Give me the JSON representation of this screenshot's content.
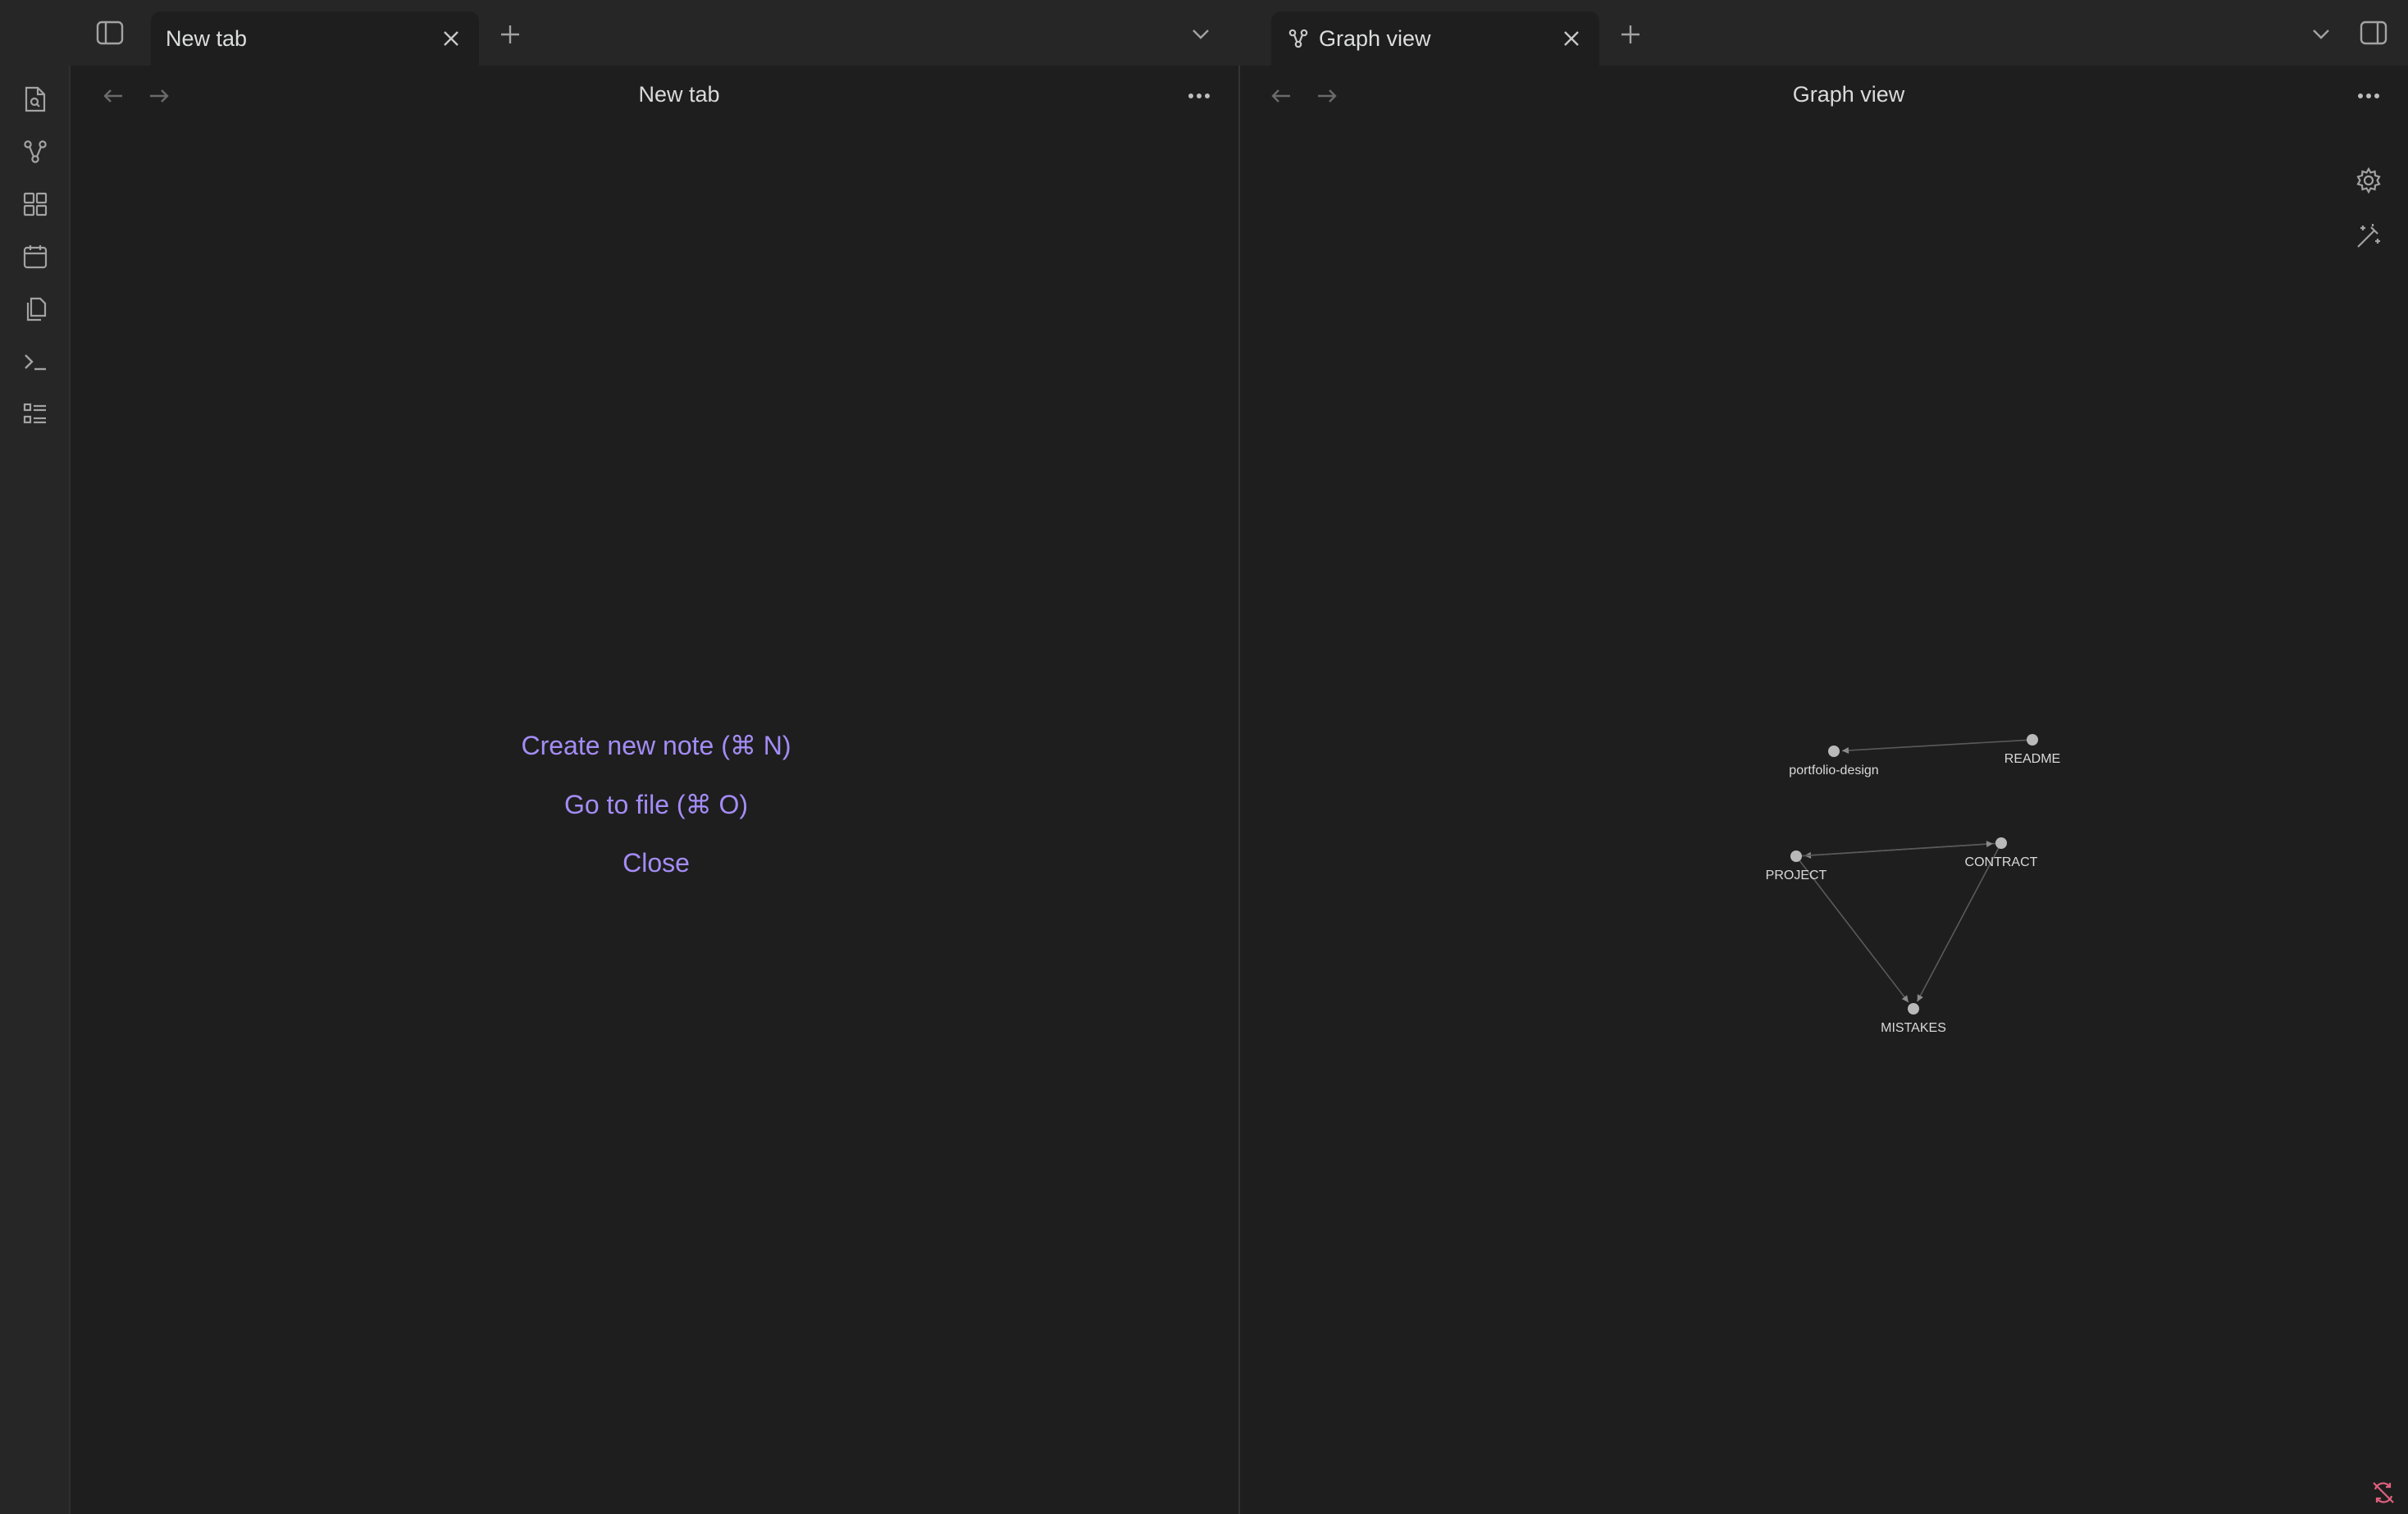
{
  "tabbar": {
    "left_tab": {
      "title": "New tab"
    },
    "right_tab": {
      "title": "Graph view"
    }
  },
  "left_pane": {
    "header_title": "New tab",
    "actions": {
      "create_note": "Create new note (⌘ N)",
      "go_to_file": "Go to file (⌘ O)",
      "close": "Close"
    }
  },
  "right_pane": {
    "header_title": "Graph view",
    "graph": {
      "nodes": [
        {
          "id": "portfolio-design",
          "label": "portfolio-design"
        },
        {
          "id": "README",
          "label": "README"
        },
        {
          "id": "PROJECT",
          "label": "PROJECT"
        },
        {
          "id": "CONTRACT",
          "label": "CONTRACT"
        },
        {
          "id": "MISTAKES",
          "label": "MISTAKES"
        }
      ],
      "links": [
        {
          "from": "README",
          "to": "portfolio-design"
        },
        {
          "from": "CONTRACT",
          "to": "PROJECT"
        },
        {
          "from": "PROJECT",
          "to": "CONTRACT"
        },
        {
          "from": "PROJECT",
          "to": "MISTAKES"
        },
        {
          "from": "CONTRACT",
          "to": "MISTAKES"
        }
      ]
    }
  },
  "ribbon": {
    "icons": [
      "open-quick-switcher-icon",
      "graph-view-icon",
      "canvas-icon",
      "daily-notes-icon",
      "templates-icon",
      "command-palette-icon",
      "slides-icon"
    ]
  },
  "colors": {
    "accent": "#a48cf5",
    "background": "#1e1e1e",
    "chrome": "#262626",
    "warning": "#e0607e"
  }
}
